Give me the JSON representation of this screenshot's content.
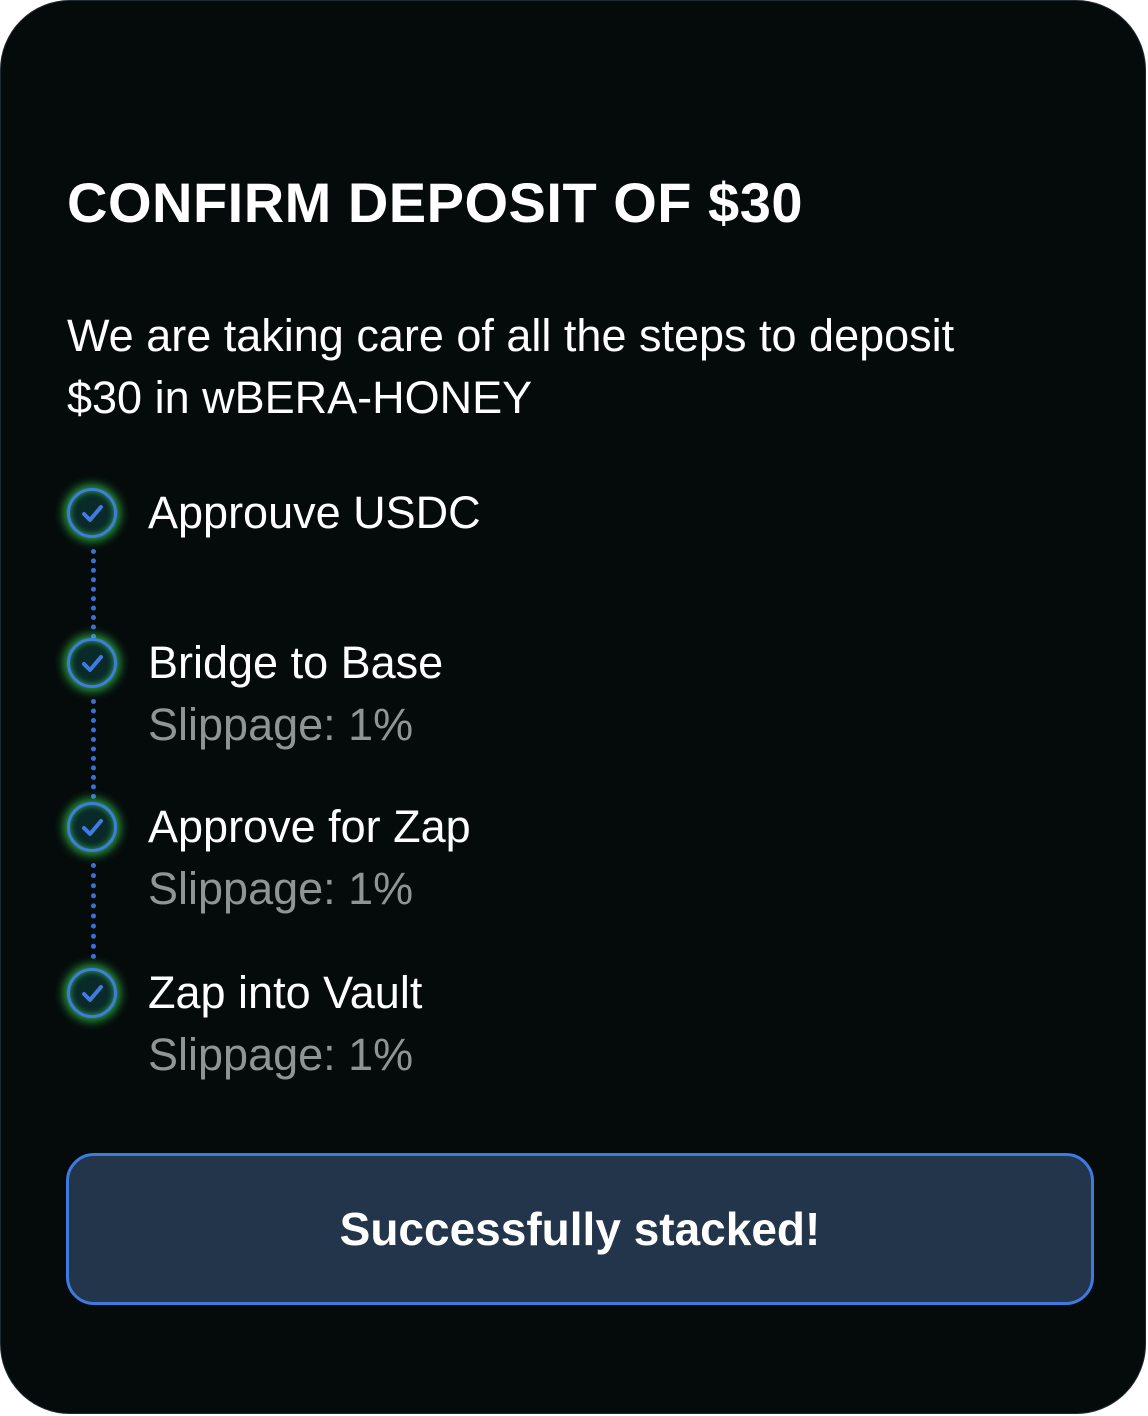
{
  "dialog": {
    "title": "CONFIRM DEPOSIT OF $30",
    "subtitle_line1": "We are taking care of all the steps to deposit",
    "subtitle_line2": "$30 in wBERA-HONEY"
  },
  "steps": [
    {
      "label": "Approuve USDC",
      "detail": "",
      "icon": "check-circle-icon",
      "status": "completed"
    },
    {
      "label": "Bridge to Base",
      "detail": "Slippage: 1%",
      "icon": "check-circle-icon",
      "status": "completed"
    },
    {
      "label": "Approve for Zap",
      "detail": "Slippage: 1%",
      "icon": "check-circle-icon",
      "status": "completed"
    },
    {
      "label": "Zap into Vault",
      "detail": "Slippage: 1%",
      "icon": "check-circle-icon",
      "status": "completed"
    }
  ],
  "action": {
    "label": "Successfully stacked!"
  },
  "colors": {
    "background": "#050b0b",
    "accent_blue": "#3d7be0",
    "button_fill": "#22354b",
    "check_glow": "#3cdc5a",
    "muted_text": "#8f9494"
  }
}
